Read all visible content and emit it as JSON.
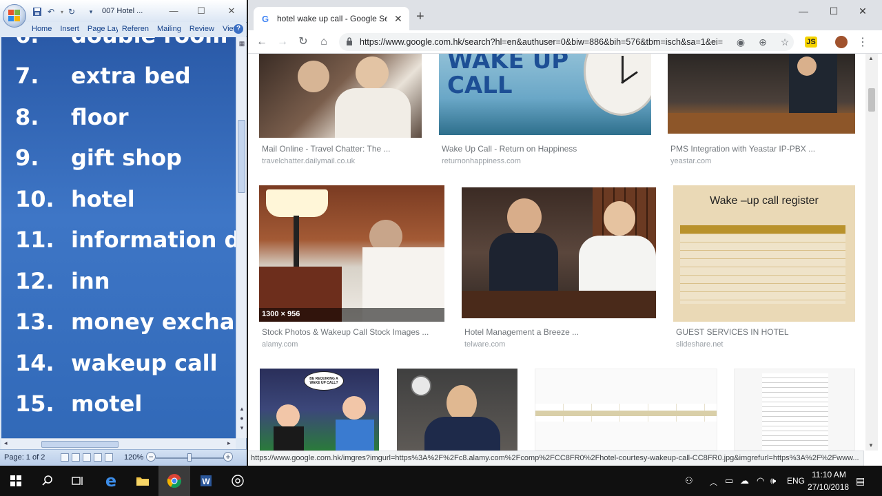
{
  "word": {
    "title": "007 Hotel ...",
    "tabs": [
      "Home",
      "Insert",
      "Page Lay",
      "Referen",
      "Mailing",
      "Review",
      "View"
    ],
    "vocab": [
      {
        "num": "6.",
        "word": "double room"
      },
      {
        "num": "7.",
        "word": "extra bed"
      },
      {
        "num": "8.",
        "word": "floor"
      },
      {
        "num": "9.",
        "word": "gift shop"
      },
      {
        "num": "10.",
        "word": "hotel"
      },
      {
        "num": "11.",
        "word": "information desk"
      },
      {
        "num": "12.",
        "word": "inn"
      },
      {
        "num": "13.",
        "word": "money exchange"
      },
      {
        "num": "14.",
        "word": "wakeup call"
      },
      {
        "num": "15.",
        "word": "motel"
      }
    ],
    "status": {
      "page": "Page: 1 of 2",
      "zoom": "120%"
    }
  },
  "chrome": {
    "tab_title": "hotel wake up call - Google Search",
    "url": "https://www.google.com.hk/search?hl=en&authuser=0&biw=886&bih=576&tbm=isch&sa=1&ei=",
    "status_url": "https://www.google.com.hk/imgres?imgurl=https%3A%2F%2Fc8.alamy.com%2Fcomp%2FCC8FR0%2Fhotel-courtesy-wakeup-call-CC8FR0.jpg&imgrefurl=https%3A%2F%2Fwww...",
    "results": [
      {
        "title": "Mail Online - Travel Chatter: The ...",
        "source": "travelchatter.dailymail.co.uk"
      },
      {
        "title": "Wake Up Call - Return on Happiness",
        "source": "returnonhappiness.com",
        "image_text": [
          "WAKE UP",
          "CALL"
        ]
      },
      {
        "title": "PMS Integration with Yeastar IP-PBX ...",
        "source": "yeastar.com"
      },
      {
        "title": "Stock Photos & Wakeup Call Stock Images ...",
        "source": "alamy.com",
        "overlay": "1300 × 956"
      },
      {
        "title": "Hotel Management a Breeze ...",
        "source": "telware.com"
      },
      {
        "title": "GUEST SERVICES IN HOTEL",
        "source": "slideshare.net",
        "image_text": [
          "Wake –up call register"
        ]
      }
    ],
    "cartoon_bubble": "BE REQUIRING A WAKE UP CALL?"
  },
  "taskbar": {
    "lang": "ENG",
    "time": "11:10 AM",
    "date": "27/10/2018"
  },
  "colors": {
    "slide_blue": "#3169b8",
    "chrome_tab_strip": "#dee1e6",
    "taskbar": "#101010"
  }
}
